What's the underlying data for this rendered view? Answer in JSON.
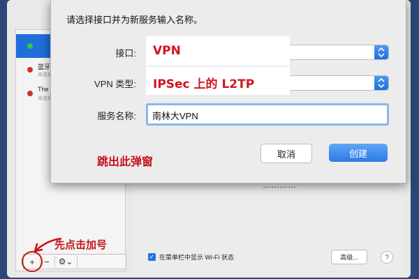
{
  "dialog": {
    "title": "请选择接口并为新服务输入名称。",
    "interface_label": "接口:",
    "interface_value": "VPN",
    "vpn_type_label": "VPN 类型:",
    "vpn_type_value": "IPSec 上的 L2TP",
    "service_name_label": "服务名称:",
    "service_name_value": "南林大VPN",
    "cancel_label": "取消",
    "create_label": "创建"
  },
  "sidebar": {
    "items": [
      {
        "name": "",
        "subtitle": "",
        "status_color": "#2ecc40",
        "selected": true
      },
      {
        "name": "蓝牙",
        "subtitle": "未连接",
        "status_color": "#d0312d",
        "selected": false
      },
      {
        "name": "The",
        "subtitle": "未连接",
        "status_color": "#d0312d",
        "selected": false
      }
    ],
    "add_label": "+",
    "remove_label": "−",
    "gear_label": "⚙⌄"
  },
  "main": {
    "partial_text": "…………",
    "wifi_checkbox_label": "在菜单栏中显示 Wi-Fi 状态",
    "wifi_checked": true,
    "advanced_label": "高级...",
    "help_label": "?"
  },
  "annotations": {
    "click_plus": "先点击加号",
    "popup": "跳出此弹窗"
  },
  "colors": {
    "accent": "#1f74e0",
    "annotation_red": "#c2151b",
    "desktop": "#2a4778"
  }
}
